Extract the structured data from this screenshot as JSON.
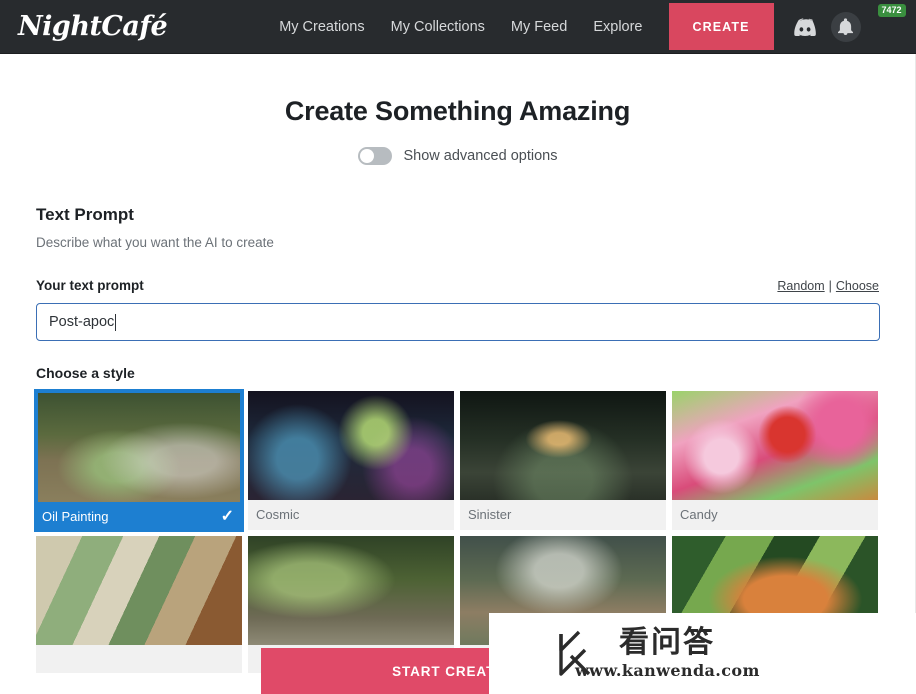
{
  "header": {
    "logo": "NightCafé",
    "nav": [
      {
        "label": "My Creations"
      },
      {
        "label": "My Collections"
      },
      {
        "label": "My Feed"
      },
      {
        "label": "Explore"
      }
    ],
    "create_button": "CREATE",
    "icons": {
      "discord": "discord-icon",
      "bell": "bell-icon",
      "avatar": "avatar"
    },
    "avatar_badge": "7472",
    "colors": {
      "bar": "#282b2e",
      "create": "#d9475f",
      "badge": "#3a8f3f"
    }
  },
  "main": {
    "title": "Create Something Amazing",
    "advanced_toggle": {
      "label": "Show advanced options",
      "state": "off"
    },
    "text_prompt": {
      "heading": "Text Prompt",
      "subheading": "Describe what you want the AI to create",
      "field_label": "Your text prompt",
      "links": {
        "random": "Random",
        "separator": "|",
        "choose": "Choose"
      },
      "input_value": "Post-apoc",
      "input_placeholder": "Your text prompt"
    },
    "style_section": {
      "heading": "Choose a style",
      "styles": [
        {
          "label": "Oil Painting",
          "selected": true,
          "art": "t-oil"
        },
        {
          "label": "Cosmic",
          "selected": false,
          "art": "t-cosmic"
        },
        {
          "label": "Sinister",
          "selected": false,
          "art": "t-sinister"
        },
        {
          "label": "Candy",
          "selected": false,
          "art": "t-candy"
        },
        {
          "label": "",
          "selected": false,
          "art": "t-cubist"
        },
        {
          "label": "",
          "selected": false,
          "art": "t-stone"
        },
        {
          "label": "",
          "selected": false,
          "art": "t-smoke"
        },
        {
          "label": "",
          "selected": false,
          "art": "t-jungle"
        }
      ],
      "selected_checkmark": "✓",
      "selected_color": "#1d7fd1"
    },
    "start_button": "START CREATING"
  },
  "watermark": {
    "logo": "k-logo",
    "brand_cn": "看问答",
    "url": "www.kanwenda.com"
  }
}
